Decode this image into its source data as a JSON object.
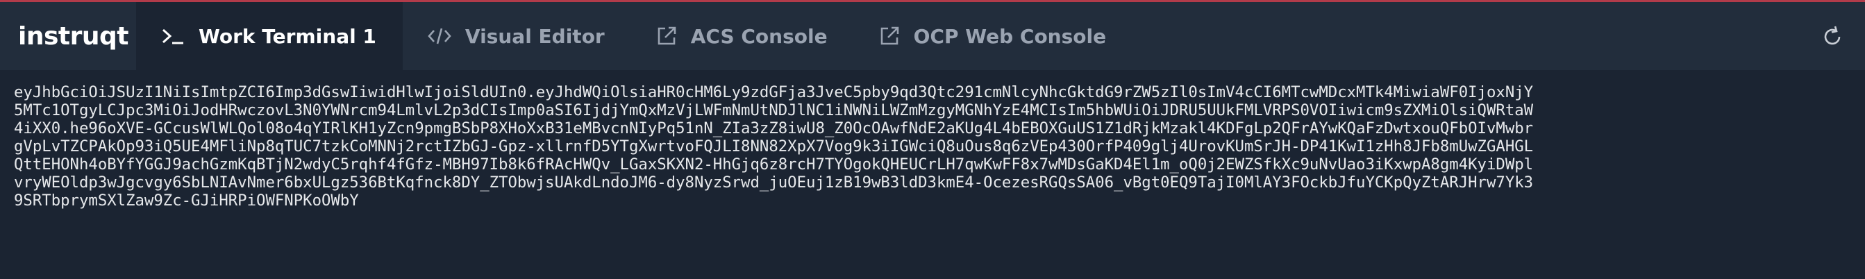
{
  "app": {
    "logo_text": "instruqt"
  },
  "tabs": [
    {
      "label": "Work Terminal 1",
      "icon": "terminal-icon",
      "active": true
    },
    {
      "label": "Visual Editor",
      "icon": "code-icon",
      "active": false
    },
    {
      "label": "ACS Console",
      "icon": "external-link-icon",
      "active": false
    },
    {
      "label": "OCP Web Console",
      "icon": "external-link-icon",
      "active": false
    }
  ],
  "toolbar": {
    "refresh_icon": "refresh-icon"
  },
  "terminal": {
    "lines": [
      "eyJhbGciOiJSUzI1NiIsImtpZCI6Imp3dGswIiwidHlwIjoiSldUIn0.eyJhdWQiOlsiaHR0cHM6Ly9zdGFja3JveC5pby9qd3Qtc291cmNlcyNhcGktdG9rZW5zIl0sImV4cCI6MTcwMDcxMTk4MiwiaWF0IjoxNjY",
      "5MTc1OTgyLCJpc3MiOiJodHRwczovL3N0YWNrcm94LmlvL2p3dCIsImp0aSI6IjdjYmQxMzVjLWFmNmUtNDJlNC1iNWNiLWZmMzgyMGNhYzE4MCIsIm5hbWUiOiJDRU5UUkFMLVRPS0VOIiwicm9sZXMiOlsiQWRtaW",
      "4iXX0.he96oXVE-GCcusWlWLQol08o4qYIRlKH1yZcn9pmgBSbP8XHoXxB31eMBvcnNIyPq51nN_ZIa3zZ8iwU8_Z0OcOAwfNdE2aKUg4L4bEBOXGuUS1Z1dRjkMzakl4KDFgLp2QFrAYwKQaFzDwtxouQFbOIvMwbr",
      "gVpLvTZCPAkOp93iQ5UE4MFliNp8qTUC7tzkCoMNNj2rctIZbGJ-Gpz-xllrnfD5YTgXwrtvoFQJLI8NN82XpX7Vog9k3iIGWciQ8uOus8q6zVEp430OrfP409glj4UrovKUmSrJH-DP41KwI1zHh8JFb8mUwZGAHGL",
      "QttEHONh4oBYfYGGJ9achGzmKqBTjN2wdyC5rqhf4fGfz-MBH97Ib8k6fRAcHWQv_LGaxSKXN2-HhGjq6z8rcH7TYOgokQHEUCrLH7qwKwFF8x7wMDsGaKD4El1m_oQ0j2EWZSfkXc9uNvUao3iKxwpA8gm4KyiDWpl",
      "vryWEOldp3wJgcvgy6SbLNIAvNmer6bxULgz536BtKqfnck8DY_ZTObwjsUAkdLndoJM6-dy8NyzSrwd_juOEuj1zB19wB3ldD3kmE4-OcezesRGQsSA06_vBgt0EQ9TajI0MlAY3FOckbJfuYCKpQyZtARJHrw7Yk3",
      "9SRTbprymSXlZaw9Zc-GJiHRPiOWFNPKoOWbY"
    ],
    "prompt": "~"
  }
}
